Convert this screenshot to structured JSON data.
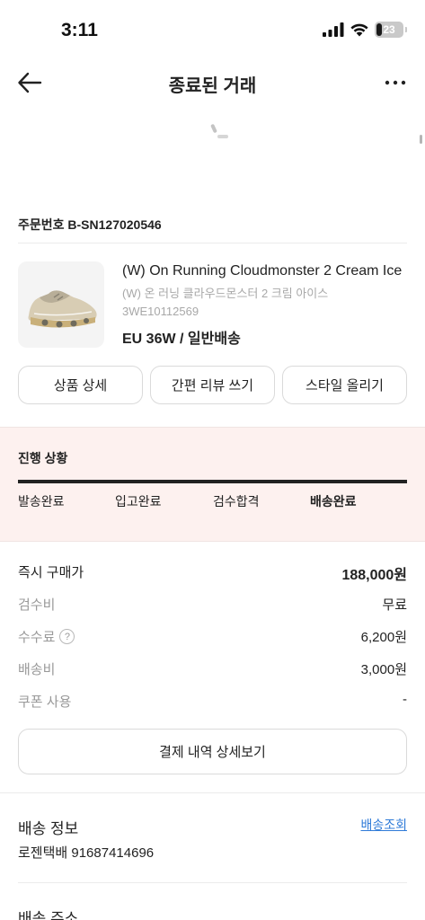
{
  "status_bar": {
    "time": "3:11",
    "battery": "23",
    "battery_level": 0.23,
    "icons": [
      "signal-icon",
      "wifi-icon",
      "battery-icon"
    ]
  },
  "nav": {
    "title": "종료된 거래",
    "back_icon": "arrow-left-icon",
    "more_icon": "more-dots-icon"
  },
  "order": {
    "number_label": "주문번호 B-SN127020546"
  },
  "product": {
    "name": "(W) On Running Cloudmonster 2 Cream Ice",
    "name_kor": "(W) 온 러닝 클라우드몬스터 2 크림 아이스",
    "code": "3WE10112569",
    "option": "EU 36W / 일반배송"
  },
  "actions": {
    "product_detail": "상품 상세",
    "quick_review": "간편 리뷰 쓰기",
    "style_post": "스타일 올리기"
  },
  "progress": {
    "title": "진행 상황",
    "steps": [
      "발송완료",
      "입고완료",
      "검수합격",
      "배송완료"
    ],
    "active_step": 3,
    "completion": 1.0
  },
  "price": {
    "rows": [
      {
        "label": "즉시 구매가",
        "value": "188,000원"
      },
      {
        "label": "검수비",
        "value": "무료"
      },
      {
        "label": "수수료",
        "value": "6,200원",
        "help": "?"
      },
      {
        "label": "배송비",
        "value": "3,000원"
      },
      {
        "label": "쿠폰 사용",
        "value": "-"
      }
    ],
    "detail_button": "결제 내역 상세보기"
  },
  "shipping": {
    "title": "배송 정보",
    "track_link": "배송조회",
    "carrier": "로젠택배 91687414696"
  },
  "address": {
    "title": "배송 주소"
  },
  "colors": {
    "progress_bg": "#fdf1ef",
    "link": "#2f7bd8",
    "text": "#222222",
    "muted": "#999999"
  }
}
